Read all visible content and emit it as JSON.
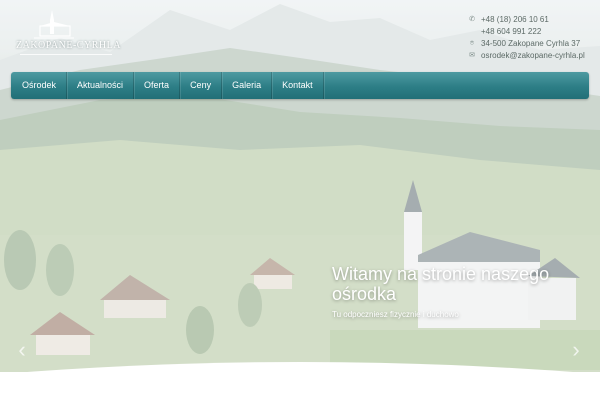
{
  "logo": {
    "brand_text": "ZAKOPANE-CYRHLA"
  },
  "contact": {
    "phone1": "+48 (18) 206 10 61",
    "phone2": "+48 604 991 222",
    "address": "34-500 Zakopane Cyrhla 37",
    "email": "osrodek@zakopane-cyrhla.pl"
  },
  "nav": {
    "items": [
      "Ośrodek",
      "Aktualności",
      "Oferta",
      "Ceny",
      "Galeria",
      "Kontakt"
    ]
  },
  "hero": {
    "title_line1": "Witamy na stronie naszego",
    "title_line2": "ośrodka",
    "subtitle": "Tu odpoczniesz fizycznie i duchowo"
  },
  "icons": {
    "phone": "phone-icon",
    "location": "location-pin-icon",
    "email": "envelope-icon",
    "prev": "chevron-left-icon",
    "next": "chevron-right-icon"
  },
  "colors": {
    "nav_top": "#4e9aa1",
    "nav_bottom": "#226f77",
    "contact_text": "#5c6a66",
    "headline_text": "#ffffff"
  }
}
